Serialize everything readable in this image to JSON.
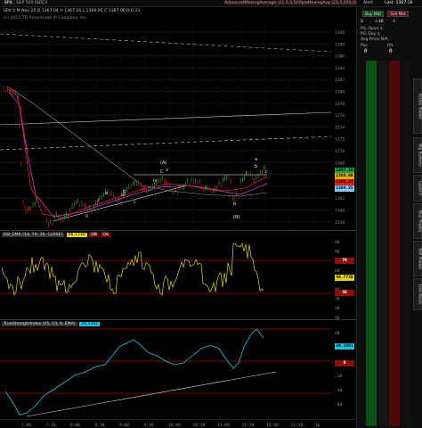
{
  "topbar": {
    "symbol": "SPX",
    "description": "S&P 500 INDEX",
    "flags": "H I",
    "study_tags": [
      "AdvancedMovingAverage (21,5,3,300)",
      "SimpleMovingAvg (21,5,200,0)"
    ],
    "right_items": [
      "Alert",
      "Last: 1367.16"
    ]
  },
  "price_panel": {
    "quote_line": "SPX 5 M  Nov 25  D 1367.04  H 1367.16  L 1366.95  C 1367.00  R 0.23",
    "copyright": "(c) 2012 TD Ameritrade IP Company, Inc.",
    "price_ticks": [
      "1390",
      "1388",
      "1386",
      "1384",
      "1382",
      "1380",
      "1378",
      "1376",
      "1374",
      "1372",
      "1370",
      "1368",
      "1366",
      "1364",
      "1362",
      "1360",
      "1358"
    ],
    "tags": [
      {
        "value": "1367.16",
        "color": "#17a34a"
      },
      {
        "value": "1366.80",
        "color": "#d4b100"
      },
      {
        "value": "1365.37",
        "color": "#d22"
      },
      {
        "value": "1364.25",
        "color": "#7ecbff"
      }
    ],
    "wave_labels": [
      "(A)",
      "C",
      "(B)",
      "a",
      "b",
      "c",
      "i",
      "ii",
      "iii",
      "iv",
      "v",
      "a",
      "b",
      "c",
      "i",
      "b"
    ]
  },
  "rsi_panel": {
    "header": [
      "RSI_EMA (14, 70, 30, CLOSE)",
      "46.7730",
      "OB",
      "OS"
    ],
    "ticks": [
      "90",
      "80",
      "70",
      "60",
      "50",
      "40",
      "30",
      "20",
      "10"
    ],
    "value": "46.7730",
    "tag_ob": "70",
    "tag_os": "30"
  },
  "tsi_panel": {
    "header": [
      "TrueStrengthIndex (25, 13, 8, EMA)",
      "26.1561"
    ],
    "ticks": [
      "40",
      "20",
      "0",
      "-20",
      "-40",
      "-60"
    ],
    "value": "26.1561",
    "zero_tag": "0"
  },
  "time_axis": {
    "labels": [
      "7:00",
      "7:30",
      "8:00",
      "8:30",
      "9:00",
      "9:30",
      "10:00",
      "10:30",
      "11:00",
      "11:30",
      "12:00",
      "12:30",
      "1p"
    ]
  },
  "side_panel": {
    "symbol_btn": "Buy Mkt",
    "sell_btn": "Sell Mkt",
    "qty": "+16",
    "bid_label": "B",
    "ask_label": "A",
    "pl_open": "P/L Open  $",
    "pl_day": "P/L Day  $",
    "avg_price": "Avg Price N/A",
    "position_label": "Pos",
    "position_value": "0",
    "pl_label": "P/L",
    "pl_value": "0",
    "tabs": [
      "Active Trader",
      "Big Buttons",
      "Level II",
      "Buy Trades",
      "Sell Trades",
      "Live News"
    ],
    "colors": {
      "bid_column": "#0a4f14",
      "ask_column": "#4d0808"
    }
  }
}
